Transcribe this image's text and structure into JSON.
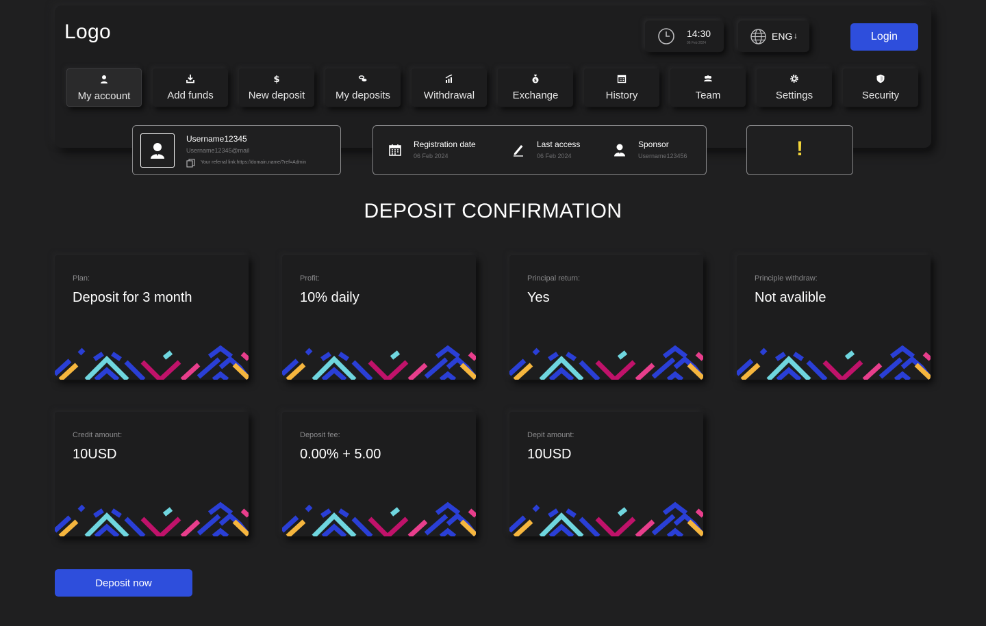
{
  "header": {
    "logo": "Logo",
    "clock": {
      "time": "14:30",
      "date": "06 Feb 2024",
      "icon": "clock-icon"
    },
    "language": {
      "value": "ENG",
      "arrow": "↓",
      "icon": "globe-icon"
    },
    "login_label": "Login"
  },
  "nav": {
    "items": [
      {
        "label": "My account",
        "icon": "user-icon",
        "active": true
      },
      {
        "label": "Add funds",
        "icon": "download-icon"
      },
      {
        "label": "New deposit",
        "icon": "dollar-icon"
      },
      {
        "label": "My deposits",
        "icon": "coins-icon"
      },
      {
        "label": "Withdrawal",
        "icon": "chart-up-icon"
      },
      {
        "label": "Exchange",
        "icon": "money-bag-icon"
      },
      {
        "label": "History",
        "icon": "calendar-icon"
      },
      {
        "label": "Team",
        "icon": "team-icon"
      },
      {
        "label": "Settings",
        "icon": "gear-icon"
      },
      {
        "label": "Security",
        "icon": "shield-icon"
      }
    ]
  },
  "user": {
    "username": "Username12345",
    "email": "Username12345@mail",
    "referral": "Your referral link:https://domain.name/?ref=Admin"
  },
  "meta": {
    "registration": {
      "label": "Registration date",
      "value": "06 Feb 2024"
    },
    "last_access": {
      "label": "Last access",
      "value": "06 Feb 2024"
    },
    "sponsor": {
      "label": "Sponsor",
      "value": "Username123456"
    }
  },
  "alert": {
    "symbol": "!",
    "color": "#f2d43a"
  },
  "page_title": "DEPOSIT CONFIRMATION",
  "details": [
    {
      "label": "Plan:",
      "value": "Deposit for 3 month"
    },
    {
      "label": "Profit:",
      "value": "10% daily"
    },
    {
      "label": "Principal return:",
      "value": "Yes"
    },
    {
      "label": "Principle withdraw:",
      "value": "Not avalible"
    },
    {
      "label": "Credit amount:",
      "value": "10USD"
    },
    {
      "label": "Deposit fee:",
      "value": "0.00% + 5.00"
    },
    {
      "label": "Depit amount:",
      "value": "10USD"
    }
  ],
  "deposit_button": "Deposit now",
  "colors": {
    "background": "#1f1f20",
    "accent": "#2e4edc",
    "pattern_blue": "#2a3fd6",
    "pattern_yellow": "#f6b63e",
    "pattern_cyan": "#6fd6df",
    "pattern_magenta": "#c0126a",
    "pattern_pink": "#e83e8c"
  }
}
